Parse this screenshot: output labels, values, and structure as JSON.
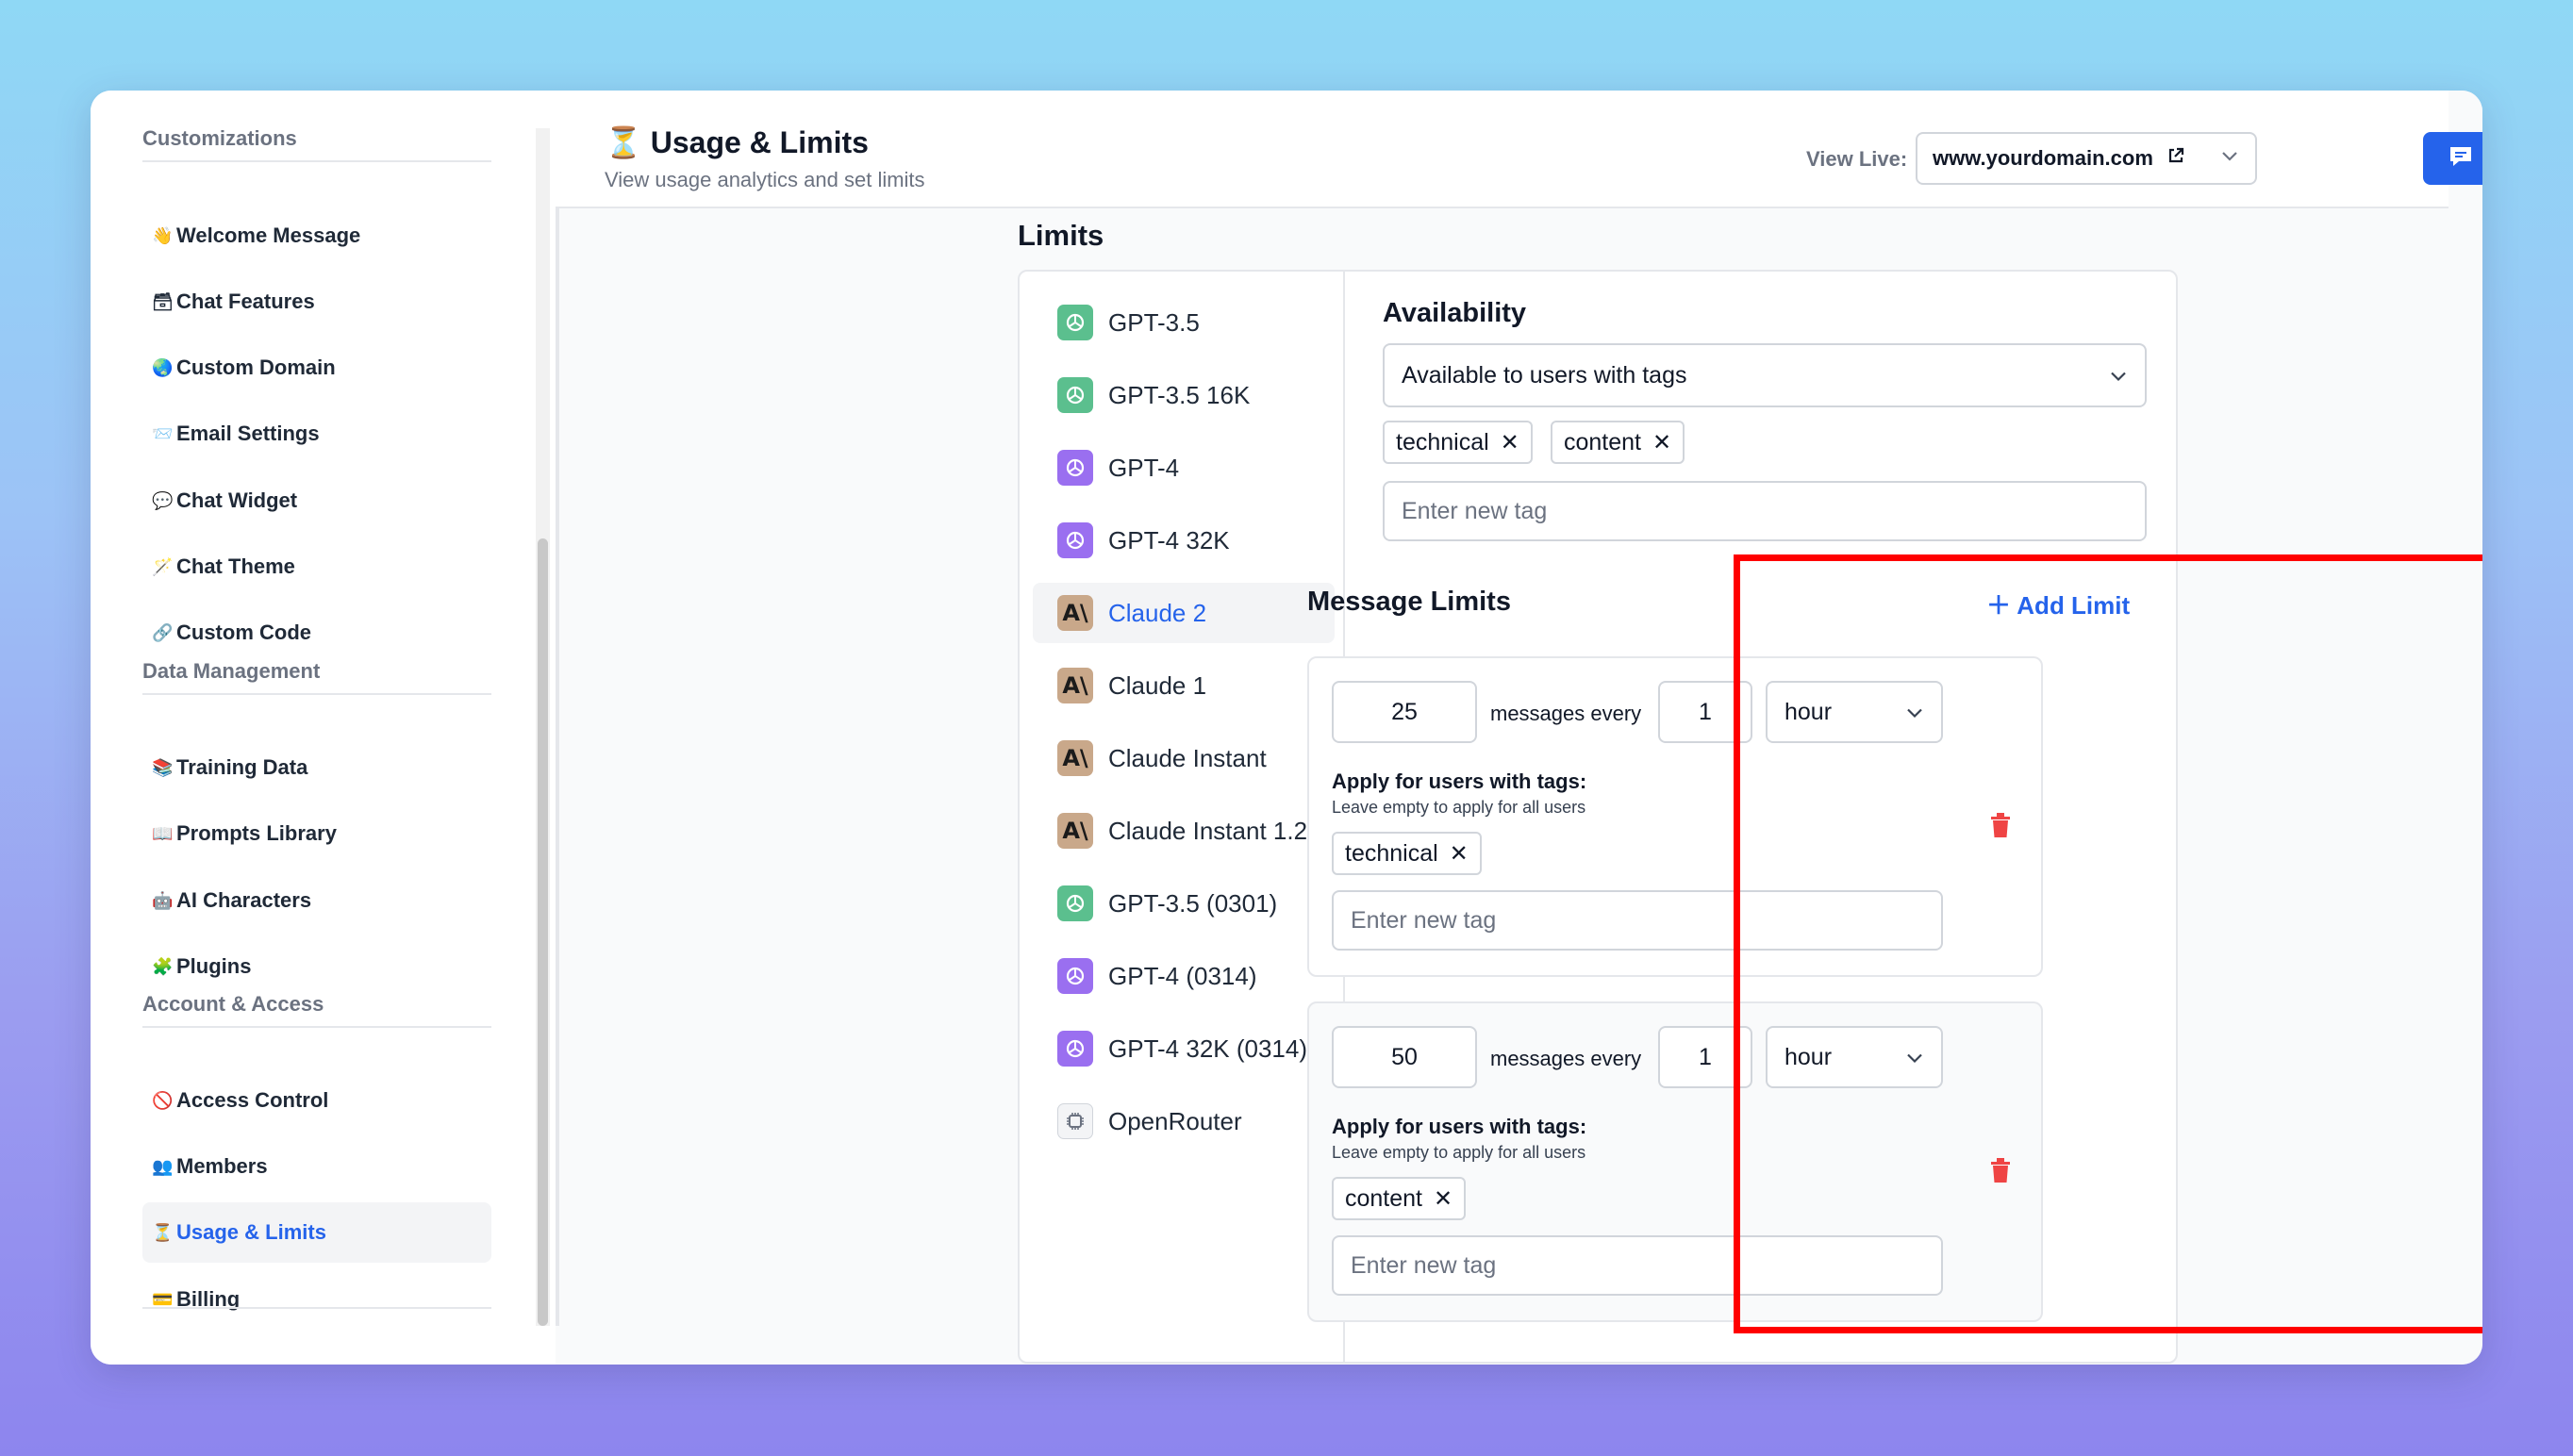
{
  "sidebar": {
    "sections": [
      {
        "title": "Customizations"
      },
      {
        "title": "Data Management"
      },
      {
        "title": "Account & Access"
      }
    ],
    "items": [
      {
        "icon": "👋",
        "label": "Welcome Message"
      },
      {
        "icon": "🗃",
        "label": "Chat Features"
      },
      {
        "icon": "🌏",
        "label": "Custom Domain"
      },
      {
        "icon": "📨",
        "label": "Email Settings"
      },
      {
        "icon": "💬",
        "label": "Chat Widget"
      },
      {
        "icon": "🪄",
        "label": "Chat Theme"
      },
      {
        "icon": "🔗",
        "label": "Custom Code"
      },
      {
        "icon": "📚",
        "label": "Training Data"
      },
      {
        "icon": "📖",
        "label": "Prompts Library"
      },
      {
        "icon": "🤖",
        "label": "AI Characters"
      },
      {
        "icon": "🧩",
        "label": "Plugins"
      },
      {
        "icon": "🚫",
        "label": "Access Control"
      },
      {
        "icon": "👥",
        "label": "Members"
      },
      {
        "icon": "⏳",
        "label": "Usage & Limits"
      },
      {
        "icon": "💳",
        "label": "Billing"
      }
    ],
    "active_item": "Usage & Limits"
  },
  "header": {
    "icon": "⏳",
    "title": "Usage & Limits",
    "subtitle": "View usage analytics and set limits",
    "view_live_label": "View Live:",
    "domain": "www.yourdomain.com"
  },
  "limits": {
    "title": "Limits",
    "models": [
      {
        "name": "GPT-3.5",
        "logo": "openai-green"
      },
      {
        "name": "GPT-3.5 16K",
        "logo": "openai-green"
      },
      {
        "name": "GPT-4",
        "logo": "openai-purple"
      },
      {
        "name": "GPT-4 32K",
        "logo": "openai-purple"
      },
      {
        "name": "Claude 2",
        "logo": "anthropic"
      },
      {
        "name": "Claude 1",
        "logo": "anthropic"
      },
      {
        "name": "Claude Instant",
        "logo": "anthropic"
      },
      {
        "name": "Claude Instant 1.2",
        "logo": "anthropic"
      },
      {
        "name": "GPT-3.5 (0301)",
        "logo": "openai-green"
      },
      {
        "name": "GPT-4 (0314)",
        "logo": "openai-purple"
      },
      {
        "name": "GPT-4 32K (0314)",
        "logo": "openai-purple"
      },
      {
        "name": "OpenRouter",
        "logo": "openrouter"
      }
    ],
    "active_model": "Claude 2",
    "availability": {
      "title": "Availability",
      "selected": "Available to users with tags",
      "tags": [
        "technical",
        "content"
      ],
      "tag_placeholder": "Enter new tag"
    },
    "message_limits": {
      "title": "Message Limits",
      "add_label": "Add Limit",
      "rules": [
        {
          "messages": "25",
          "every_label": "messages every",
          "interval": "1",
          "unit": "hour",
          "apply_title": "Apply for users with tags:",
          "apply_sub": "Leave empty to apply for all users",
          "tags": [
            "technical"
          ],
          "tag_placeholder": "Enter new tag"
        },
        {
          "messages": "50",
          "every_label": "messages every",
          "interval": "1",
          "unit": "hour",
          "apply_title": "Apply for users with tags:",
          "apply_sub": "Leave empty to apply for all users",
          "tags": [
            "content"
          ],
          "tag_placeholder": "Enter new tag"
        }
      ]
    }
  },
  "colors": {
    "accent": "#2563eb",
    "highlight_frame": "#ff0000",
    "danger": "#ef4444",
    "openai_green": "#5bbf8e",
    "openai_purple": "#9a6ff0",
    "anthropic_tan": "#c9a88a"
  }
}
